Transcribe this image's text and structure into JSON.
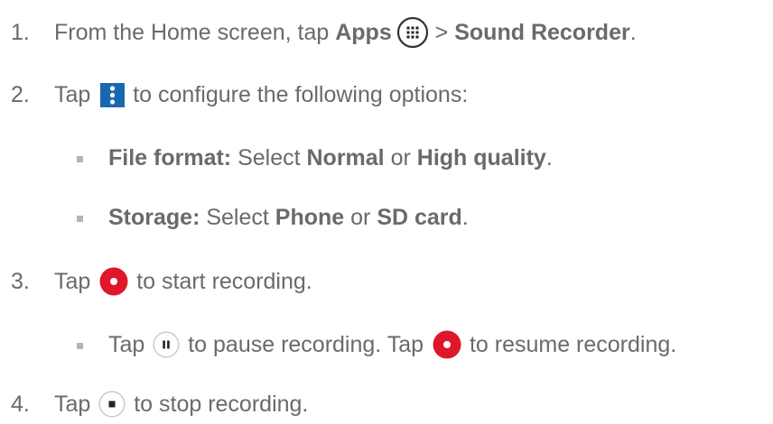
{
  "steps": {
    "s1": {
      "num": "1.",
      "pre": "From the Home screen, tap ",
      "apps": "Apps",
      "sep": " > ",
      "target": "Sound Recorder",
      "end": "."
    },
    "s2": {
      "num": "2.",
      "pre": "Tap ",
      "post": " to configure the following options:"
    },
    "s2a": {
      "label": "File format:",
      "pre": " Select ",
      "opt1": "Normal",
      "or": " or ",
      "opt2": "High quality",
      "end": "."
    },
    "s2b": {
      "label": "Storage:",
      "pre": " Select ",
      "opt1": "Phone",
      "or": " or ",
      "opt2": "SD card",
      "end": "."
    },
    "s3": {
      "num": "3.",
      "pre": "Tap ",
      "post": " to start recording."
    },
    "s3a": {
      "pre": "Tap ",
      "mid": " to pause recording. Tap ",
      "post": " to resume recording."
    },
    "s4": {
      "num": "4.",
      "pre": "Tap ",
      "post": " to stop recording."
    }
  },
  "icons": {
    "apps": "apps-grid-icon",
    "menu": "more-vert-icon",
    "record": "record-icon",
    "pause": "pause-icon",
    "stop": "stop-icon"
  },
  "colors": {
    "text": "#6a6a6a",
    "menu_blue": "#1a67b1",
    "record_red": "#e0162b",
    "bullet": "#b4b4b4"
  }
}
